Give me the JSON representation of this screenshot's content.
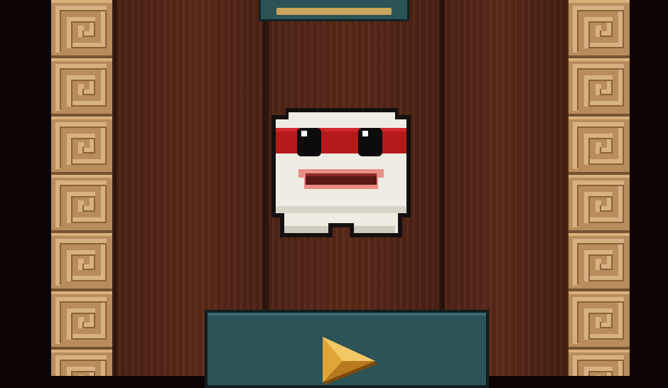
{
  "colors": {
    "wood_dark": "#4a2114",
    "pillar": "#b88c5c",
    "panel": "#2c5356",
    "arrow": "#e0a53a",
    "character_band": "#b51a1a"
  },
  "icons": {
    "character": "white-block-ninja-character",
    "play": "play-arrow-icon"
  }
}
